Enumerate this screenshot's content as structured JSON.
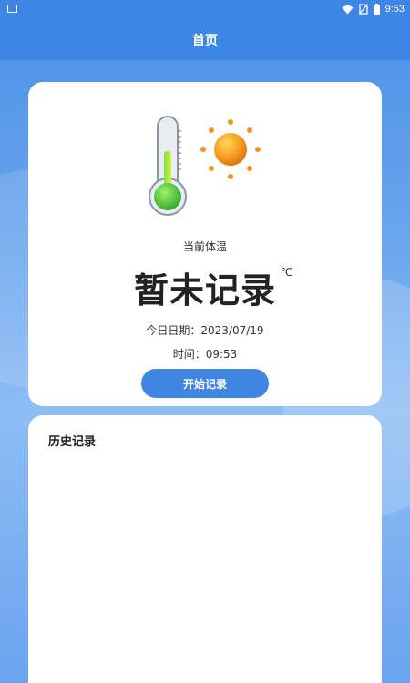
{
  "status_bar": {
    "time": "9:53"
  },
  "app_bar": {
    "title": "首页"
  },
  "temperature_card": {
    "label": "当前体温",
    "value": "暂未记录",
    "unit": "℃",
    "date_line": "今日日期：2023/07/19",
    "time_line": "时间：09:53",
    "start_button_label": "开始记录"
  },
  "history": {
    "title": "历史记录",
    "items": []
  },
  "colors": {
    "primary": "#3d86e6",
    "button": "#3f86e2",
    "card": "#ffffff"
  },
  "icons": [
    "image-icon",
    "wifi-icon",
    "no-sim-icon",
    "battery-icon",
    "thermometer-icon",
    "sun-icon"
  ]
}
